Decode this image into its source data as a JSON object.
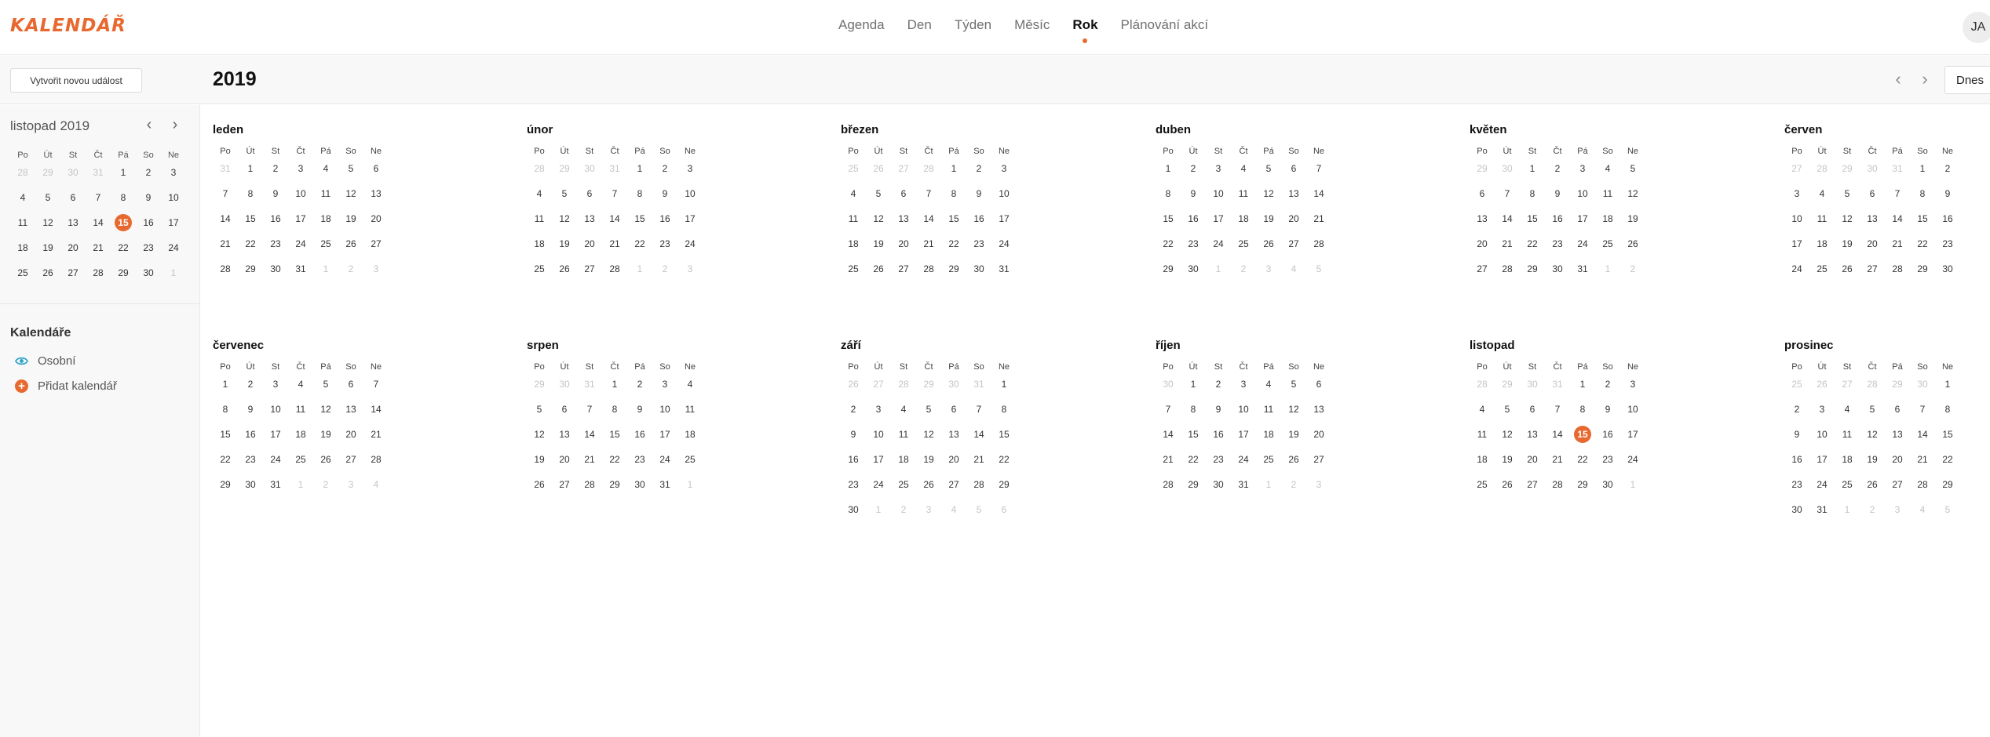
{
  "app": {
    "logo": "KALENDÁŘ",
    "user_initials": "JA"
  },
  "nav": {
    "items": [
      "Agenda",
      "Den",
      "Týden",
      "Měsíc",
      "Rok",
      "Plánování akcí"
    ],
    "active_index": 4
  },
  "toolbar": {
    "new_event_label": "Vytvořit novou událost",
    "year": "2019",
    "prev_icon": "chevron-left-icon",
    "next_icon": "chevron-right-icon",
    "today_label": "Dnes"
  },
  "weekdays": [
    "Po",
    "Út",
    "St",
    "Čt",
    "Pá",
    "So",
    "Ne"
  ],
  "mini_calendar": {
    "title": "listopad 2019",
    "weeks": [
      [
        [
          "28",
          1
        ],
        [
          "29",
          1
        ],
        [
          "30",
          1
        ],
        [
          "31",
          1
        ],
        [
          "1",
          0
        ],
        [
          "2",
          0
        ],
        [
          "3",
          0
        ]
      ],
      [
        [
          "4",
          0
        ],
        [
          "5",
          0
        ],
        [
          "6",
          0
        ],
        [
          "7",
          0
        ],
        [
          "8",
          0
        ],
        [
          "9",
          0
        ],
        [
          "10",
          0
        ]
      ],
      [
        [
          "11",
          0
        ],
        [
          "12",
          0
        ],
        [
          "13",
          0
        ],
        [
          "14",
          0
        ],
        [
          "15",
          0
        ],
        [
          "16",
          0
        ],
        [
          "17",
          0
        ]
      ],
      [
        [
          "18",
          0
        ],
        [
          "19",
          0
        ],
        [
          "20",
          0
        ],
        [
          "21",
          0
        ],
        [
          "22",
          0
        ],
        [
          "23",
          0
        ],
        [
          "24",
          0
        ]
      ],
      [
        [
          "25",
          0
        ],
        [
          "26",
          0
        ],
        [
          "27",
          0
        ],
        [
          "28",
          0
        ],
        [
          "29",
          0
        ],
        [
          "30",
          0
        ],
        [
          "1",
          1
        ]
      ]
    ],
    "today_cell": [
      2,
      4
    ]
  },
  "calendars": {
    "title": "Kalendáře",
    "items": [
      {
        "label": "Osobní",
        "icon": "eye-icon"
      },
      {
        "label": "Přidat kalendář",
        "icon": "plus-icon"
      }
    ]
  },
  "months": [
    {
      "name": "leden",
      "lead": [
        "31"
      ],
      "days": 31,
      "trail": 3
    },
    {
      "name": "únor",
      "lead": [
        "28",
        "29",
        "30",
        "31"
      ],
      "days": 28,
      "trail": 3
    },
    {
      "name": "březen",
      "lead": [
        "25",
        "26",
        "27",
        "28"
      ],
      "days": 31,
      "trail": 0
    },
    {
      "name": "duben",
      "lead": [],
      "days": 30,
      "trail": 5
    },
    {
      "name": "květen",
      "lead": [
        "29",
        "30"
      ],
      "days": 31,
      "trail": 2
    },
    {
      "name": "červen",
      "lead": [
        "27",
        "28",
        "29",
        "30",
        "31"
      ],
      "days": 30,
      "trail": 0
    },
    {
      "name": "červenec",
      "lead": [],
      "days": 31,
      "trail": 4
    },
    {
      "name": "srpen",
      "lead": [
        "29",
        "30",
        "31"
      ],
      "days": 31,
      "trail": 1
    },
    {
      "name": "září",
      "lead": [
        "26",
        "27",
        "28",
        "29",
        "30",
        "31"
      ],
      "days": 30,
      "trail": 6
    },
    {
      "name": "říjen",
      "lead": [
        "30"
      ],
      "days": 31,
      "trail": 3
    },
    {
      "name": "listopad",
      "lead": [
        "28",
        "29",
        "30",
        "31"
      ],
      "days": 30,
      "trail": 1
    },
    {
      "name": "prosinec",
      "lead": [
        "25",
        "26",
        "27",
        "28",
        "29",
        "30"
      ],
      "days": 31,
      "trail": 5
    }
  ],
  "today": {
    "month_index": 10,
    "day": 15
  },
  "colors": {
    "accent": "#e8692f",
    "personal_calendar": "#2fa3c8"
  }
}
